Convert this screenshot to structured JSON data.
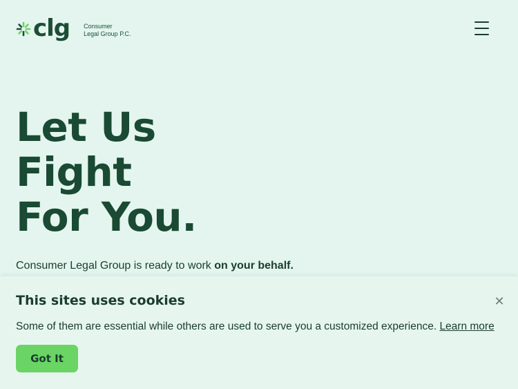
{
  "brand": {
    "wordmark": "clg",
    "name_line1": "Consumer",
    "name_line2": "Legal Group P.C.",
    "logo_icon": "sunburst-icon",
    "accent_color": "#6ad465",
    "text_color": "#1a4a33"
  },
  "header": {
    "menu_icon": "hamburger-menu-icon"
  },
  "hero": {
    "title_line1": "Let Us",
    "title_line2": "Fight",
    "title_line3": "For You.",
    "subtitle_prefix": "Consumer Legal Group is ready to work ",
    "subtitle_bold": "on your behalf."
  },
  "cookie_banner": {
    "title": "This sites uses cookies",
    "message": "Some of them are essential while others are used to serve you a customized experience. ",
    "link_label": "Learn more",
    "button_label": "Got It",
    "close_icon": "close-icon"
  }
}
